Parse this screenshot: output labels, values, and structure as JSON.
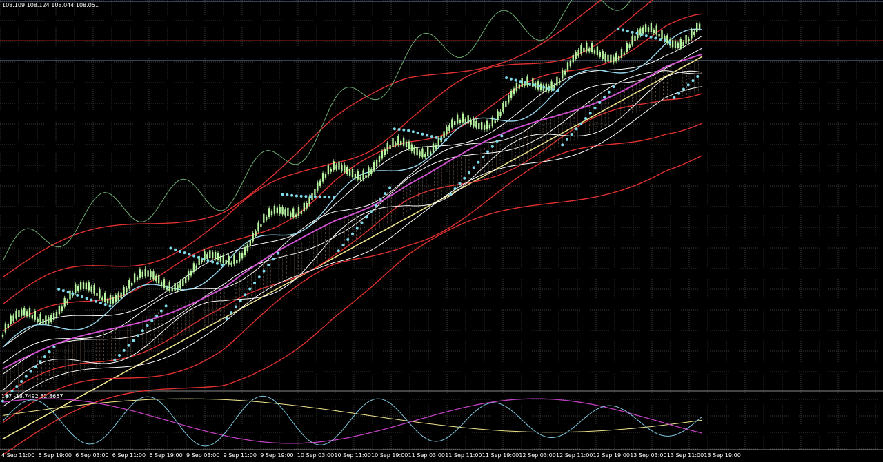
{
  "chart_data": {
    "type": "line",
    "ohlc_header": "108.109 108.124 108.044 108.051",
    "oscillator_header": "167 -18.7492 82.8657",
    "x_ticks": [
      "4 Sep 11:00",
      "5 Sep 19:00",
      "6 Sep 03:00",
      "6 Sep 11:00",
      "6 Sep 19:00",
      "9 Sep 03:00",
      "9 Sep 11:00",
      "9 Sep 19:00",
      "10 Sep 03:00",
      "10 Sep 11:00",
      "10 Sep 19:00",
      "11 Sep 03:00",
      "11 Sep 11:00",
      "11 Sep 19:00",
      "12 Sep 03:00",
      "12 Sep 11:00",
      "12 Sep 19:00",
      "13 Sep 03:00",
      "13 Sep 11:00",
      "13 Sep 19:00"
    ],
    "price_trend": [
      106.9,
      106.95,
      107.0,
      107.05,
      107.1,
      107.15,
      107.2,
      107.28,
      107.36,
      107.45,
      107.52,
      107.6,
      107.66,
      107.72,
      107.78,
      107.84,
      107.9,
      107.96,
      108.02,
      108.05
    ],
    "colors": {
      "background": "#000000",
      "grid": "#3a3a3a",
      "candle": "#b8f5a0",
      "bollinger": "#e03030",
      "envelope": "#ffffff",
      "lagging": "#6fae74",
      "psar": "#7fd8e8",
      "ma_long": "#f0e68c",
      "ma_mid": "#d050d0",
      "ma_fast": "#9ad8f0",
      "osc_main": "#7fc8e0",
      "osc_signal": "#c040c0",
      "osc_slow": "#f0e68c"
    }
  }
}
